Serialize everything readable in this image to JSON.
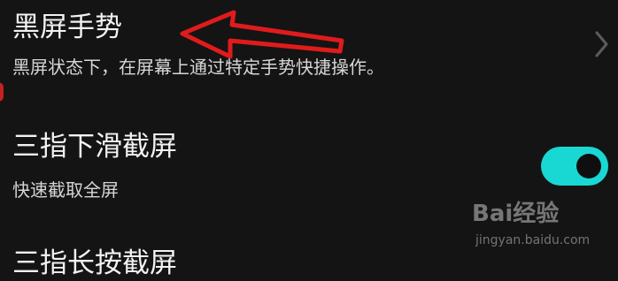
{
  "settings": {
    "items": [
      {
        "title": "黑屏手势",
        "description": "黑屏状态下，在屏幕上通过特定手势快捷操作。",
        "control": "chevron-right"
      },
      {
        "title": "三指下滑截屏",
        "description": "快速截取全屏",
        "control": "toggle",
        "toggle_on": true
      },
      {
        "title": "三指长按截屏",
        "control": "none",
        "partially_visible": true
      }
    ]
  },
  "colors": {
    "background": "#141414",
    "toggle_on": "#19d8d3",
    "annotation_arrow": "#e01b1b"
  },
  "watermark": {
    "logo": "Bai经验",
    "url": "jingyan.baidu.com"
  }
}
